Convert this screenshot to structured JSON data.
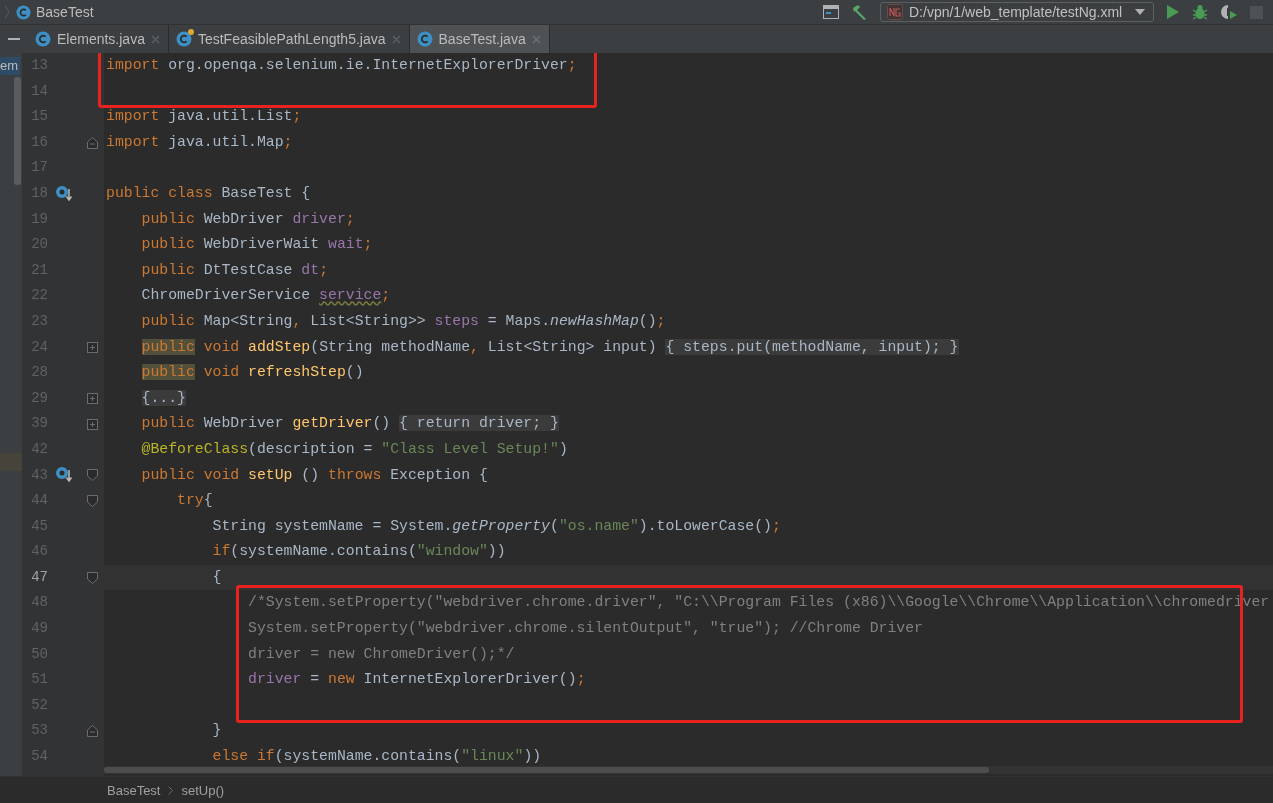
{
  "navigation_bar": {
    "class_name": "BaseTest"
  },
  "run_configuration": {
    "path": "D:/vpn/1/web_template/testNg.xml"
  },
  "tabs": [
    {
      "label": "Elements.java",
      "selected": false,
      "badge": false
    },
    {
      "label": "TestFeasiblePathLength5.java",
      "selected": false,
      "badge": true
    },
    {
      "label": "BaseTest.java",
      "selected": true,
      "badge": false
    }
  ],
  "project_panel": {
    "label": "em"
  },
  "code_lines": [
    {
      "number": "13",
      "kind": "top",
      "boxed": true,
      "current": false,
      "segments": [
        {
          "kind": "keyword",
          "text": "import"
        },
        {
          "kind": "plain",
          "text": " org.openqa.selenium.ie.InternetExplorerDriver"
        },
        {
          "kind": "punct",
          "text": ";"
        }
      ]
    },
    {
      "number": "14",
      "kind": "top",
      "boxed": true,
      "current": false
    },
    {
      "number": "15",
      "kind": "top",
      "boxed": false,
      "current": false,
      "segments": [
        {
          "kind": "keyword",
          "text": "import"
        },
        {
          "kind": "plain",
          "text": " java.util.List"
        },
        {
          "kind": "punct",
          "text": ";"
        }
      ]
    },
    {
      "number": "16",
      "kind": "top",
      "boxed": false,
      "current": false,
      "markers": [
        {
          "kind": "fold_end"
        }
      ],
      "segments": [
        {
          "kind": "keyword",
          "text": "import"
        },
        {
          "kind": "plain",
          "text": " java.util.Map"
        },
        {
          "kind": "punct",
          "text": ";"
        }
      ]
    },
    {
      "number": "17",
      "kind": "top",
      "boxed": false,
      "current": false
    },
    {
      "number": "18",
      "kind": "top",
      "boxed": false,
      "current": false,
      "markers": [
        {
          "kind": "implemented"
        }
      ],
      "segments": [
        {
          "kind": "keyword",
          "text": "public class"
        },
        {
          "kind": "plain",
          "text": " BaseTest {"
        }
      ]
    },
    {
      "number": "19",
      "kind": "member",
      "boxed": false,
      "current": false,
      "segments": [
        {
          "kind": "keyword",
          "text": "public"
        },
        {
          "kind": "plain",
          "text": " WebDriver "
        },
        {
          "kind": "field",
          "text": "driver"
        },
        {
          "kind": "punct",
          "text": ";"
        }
      ]
    },
    {
      "number": "20",
      "kind": "member",
      "boxed": false,
      "current": false,
      "segments": [
        {
          "kind": "keyword",
          "text": "public"
        },
        {
          "kind": "plain",
          "text": " WebDriverWait "
        },
        {
          "kind": "field",
          "text": "wait"
        },
        {
          "kind": "punct",
          "text": ";"
        }
      ]
    },
    {
      "number": "21",
      "kind": "member",
      "boxed": false,
      "current": false,
      "segments": [
        {
          "kind": "keyword",
          "text": "public"
        },
        {
          "kind": "plain",
          "text": " DtTestCase "
        },
        {
          "kind": "field",
          "text": "dt"
        },
        {
          "kind": "punct",
          "text": ";"
        }
      ]
    },
    {
      "number": "22",
      "kind": "member",
      "boxed": false,
      "current": false,
      "segments": [
        {
          "kind": "plain",
          "text": "ChromeDriverService "
        },
        {
          "kind": "warning",
          "text": "service"
        },
        {
          "kind": "punct",
          "text": ";"
        }
      ]
    },
    {
      "number": "23",
      "kind": "member",
      "boxed": false,
      "current": false,
      "segments": [
        {
          "kind": "keyword",
          "text": "public"
        },
        {
          "kind": "plain",
          "text": " Map<String"
        },
        {
          "kind": "punct",
          "text": ","
        },
        {
          "kind": "plain",
          "text": " List<String>> "
        },
        {
          "kind": "field",
          "text": "steps"
        },
        {
          "kind": "plain",
          "text": " = Maps."
        },
        {
          "kind": "static",
          "text": "newHashMap"
        },
        {
          "kind": "plain",
          "text": "()"
        },
        {
          "kind": "punct",
          "text": ";"
        }
      ]
    },
    {
      "number": "24",
      "kind": "member",
      "boxed": false,
      "current": false,
      "markers": [
        {
          "kind": "fold_collapsed"
        }
      ],
      "segments": [
        {
          "kind": "highlighted",
          "text": "public"
        },
        {
          "kind": "keyword",
          "text": " void"
        },
        {
          "kind": "method",
          "text": " addStep"
        },
        {
          "kind": "plain",
          "text": "(String methodName"
        },
        {
          "kind": "punct",
          "text": ","
        },
        {
          "kind": "plain",
          "text": " List<String> input) "
        },
        {
          "kind": "folded",
          "text": "{ steps.put(methodName, input); }"
        }
      ]
    },
    {
      "number": "28",
      "kind": "member",
      "boxed": false,
      "current": false,
      "segments": [
        {
          "kind": "highlighted",
          "text": "public"
        },
        {
          "kind": "keyword",
          "text": " void"
        },
        {
          "kind": "method",
          "text": " refreshStep"
        },
        {
          "kind": "plain",
          "text": "()"
        }
      ]
    },
    {
      "number": "29",
      "kind": "member",
      "boxed": false,
      "current": false,
      "markers": [
        {
          "kind": "fold_collapsed"
        }
      ],
      "segments": [
        {
          "kind": "folded",
          "text": "{...}"
        }
      ]
    },
    {
      "number": "39",
      "kind": "member",
      "boxed": false,
      "current": false,
      "markers": [
        {
          "kind": "fold_collapsed"
        }
      ],
      "segments": [
        {
          "kind": "keyword",
          "text": "public"
        },
        {
          "kind": "plain",
          "text": " WebDriver"
        },
        {
          "kind": "method",
          "text": " getDriver"
        },
        {
          "kind": "plain",
          "text": "() "
        },
        {
          "kind": "folded",
          "text": "{ return driver; }"
        }
      ]
    },
    {
      "number": "42",
      "kind": "member",
      "boxed": false,
      "current": false,
      "segments": [
        {
          "kind": "annotation",
          "text": "@BeforeClass"
        },
        {
          "kind": "plain",
          "text": "(description = "
        },
        {
          "kind": "string",
          "text": "\"Class Level Setup!\""
        },
        {
          "kind": "plain",
          "text": ")"
        }
      ]
    },
    {
      "number": "43",
      "kind": "member",
      "boxed": false,
      "current": false,
      "markers": [
        {
          "kind": "implemented"
        },
        {
          "kind": "fold_start"
        }
      ],
      "segments": [
        {
          "kind": "keyword",
          "text": "public void"
        },
        {
          "kind": "method",
          "text": " setUp"
        },
        {
          "kind": "plain",
          "text": " () "
        },
        {
          "kind": "keyword",
          "text": "throws"
        },
        {
          "kind": "plain",
          "text": " Exception {"
        }
      ]
    },
    {
      "number": "44",
      "kind": "body",
      "boxed": false,
      "current": false,
      "markers": [
        {
          "kind": "fold_start"
        }
      ],
      "segments": [
        {
          "kind": "keyword",
          "text": "try"
        },
        {
          "kind": "plain",
          "text": "{"
        }
      ]
    },
    {
      "number": "45",
      "kind": "block",
      "boxed": false,
      "current": false,
      "segments": [
        {
          "kind": "plain",
          "text": "String systemName = System."
        },
        {
          "kind": "static",
          "text": "getProperty"
        },
        {
          "kind": "plain",
          "text": "("
        },
        {
          "kind": "string",
          "text": "\"os.name\""
        },
        {
          "kind": "plain",
          "text": ").toLowerCase()"
        },
        {
          "kind": "punct",
          "text": ";"
        }
      ]
    },
    {
      "number": "46",
      "kind": "block",
      "boxed": false,
      "current": false,
      "segments": [
        {
          "kind": "keyword",
          "text": "if"
        },
        {
          "kind": "plain",
          "text": "(systemName.contains("
        },
        {
          "kind": "string",
          "text": "\"window\""
        },
        {
          "kind": "plain",
          "text": "))"
        }
      ]
    },
    {
      "number": "47",
      "kind": "block",
      "boxed": false,
      "current": true,
      "markers": [
        {
          "kind": "fold_start"
        }
      ],
      "segments": [
        {
          "kind": "plain",
          "text": "{"
        }
      ]
    },
    {
      "number": "48",
      "kind": "nested",
      "boxed": true,
      "current": false,
      "segments": [
        {
          "kind": "comment",
          "text": "/*System.setProperty(\"webdriver.chrome.driver\", \"C:\\\\Program Files (x86)\\\\Google\\\\Chrome\\\\Application\\\\chromedriver"
        }
      ]
    },
    {
      "number": "49",
      "kind": "nested",
      "boxed": true,
      "current": false,
      "segments": [
        {
          "kind": "comment",
          "text": "System.setProperty(\"webdriver.chrome.silentOutput\", \"true\"); //Chrome Driver"
        }
      ]
    },
    {
      "number": "50",
      "kind": "nested",
      "boxed": true,
      "current": false,
      "segments": [
        {
          "kind": "comment",
          "text": "driver = new ChromeDriver();*/"
        }
      ]
    },
    {
      "number": "51",
      "kind": "nested",
      "boxed": true,
      "current": false,
      "segments": [
        {
          "kind": "field",
          "text": "driver"
        },
        {
          "kind": "plain",
          "text": " = "
        },
        {
          "kind": "keyword",
          "text": "new"
        },
        {
          "kind": "plain",
          "text": " InternetExplorerDriver()"
        },
        {
          "kind": "punct",
          "text": ";"
        }
      ]
    },
    {
      "number": "52",
      "kind": "top",
      "boxed": true,
      "current": false
    },
    {
      "number": "53",
      "kind": "block",
      "boxed": false,
      "current": false,
      "markers": [
        {
          "kind": "fold_end"
        }
      ],
      "segments": [
        {
          "kind": "plain",
          "text": "}"
        }
      ]
    },
    {
      "number": "54",
      "kind": "block",
      "boxed": false,
      "current": false,
      "segments": [
        {
          "kind": "keyword",
          "text": "else if"
        },
        {
          "kind": "plain",
          "text": "(systemName.contains("
        },
        {
          "kind": "string",
          "text": "\"linux\""
        },
        {
          "kind": "plain",
          "text": "))"
        }
      ]
    }
  ],
  "breadcrumbs": [
    "BaseTest",
    "setUp()"
  ]
}
